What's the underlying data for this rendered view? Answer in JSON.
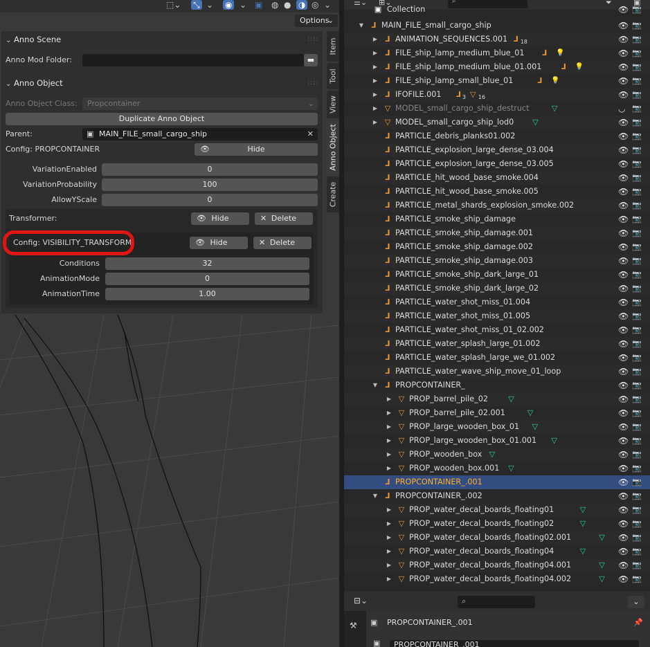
{
  "viewport": {
    "options_label": "Options"
  },
  "panel": {
    "anno_scene": {
      "title": "Anno Scene",
      "mod_folder_label": "Anno Mod Folder:",
      "mod_folder_value": ""
    },
    "anno_object": {
      "title": "Anno Object",
      "class_label": "Anno Object Class:",
      "class_value": "Propcontainer",
      "duplicate_label": "Duplicate Anno Object",
      "parent_label": "Parent:",
      "parent_value": "MAIN_FILE_small_cargo_ship",
      "config_label": "Config: PROPCONTAINER",
      "hide_label": "Hide",
      "variation_enabled_label": "VariationEnabled",
      "variation_enabled_value": "0",
      "variation_probability_label": "VariationProbability",
      "variation_probability_value": "100",
      "allow_yscale_label": "AllowYScale",
      "allow_yscale_value": "0"
    },
    "transformer": {
      "label": "Transformer:",
      "hide_label": "Hide",
      "delete_label": "Delete",
      "config_label": "Config: VISIBILITY_TRANSFORM",
      "config_hide_label": "Hide",
      "config_delete_label": "Delete",
      "conditions_label": "Conditions",
      "conditions_value": "32",
      "animation_mode_label": "AnimationMode",
      "animation_mode_value": "0",
      "animation_time_label": "AnimationTime",
      "animation_time_value": "1.00"
    },
    "tabs": [
      "Item",
      "Tool",
      "View",
      "Anno Object",
      "Create"
    ]
  },
  "outliner": {
    "collection_label": "Collection",
    "rows": [
      {
        "name": "MAIN_FILE_small_cargo_ship",
        "type": "empty",
        "expanded": true
      },
      {
        "name": "ANIMATION_SEQUENCES.001",
        "type": "empty",
        "badge": "18"
      },
      {
        "name": "FILE_ship_lamp_medium_blue_01",
        "type": "empty",
        "badge": "lamp"
      },
      {
        "name": "FILE_ship_lamp_medium_blue_01.001",
        "type": "empty",
        "badge": "lamp"
      },
      {
        "name": "FILE_ship_lamp_small_blue_01",
        "type": "empty",
        "badge": "lamp"
      },
      {
        "name": "IFOFILE.001",
        "type": "empty",
        "badge_a": "3",
        "badge_b": "16"
      },
      {
        "name": "MODEL_small_cargo_ship_destruct",
        "type": "mesh",
        "hidden": true
      },
      {
        "name": "MODEL_small_cargo_ship_lod0",
        "type": "mesh"
      },
      {
        "name": "PARTICLE_debris_planks01.002",
        "type": "empty"
      },
      {
        "name": "PARTICLE_explosion_large_dense_03.004",
        "type": "empty"
      },
      {
        "name": "PARTICLE_explosion_large_dense_03.005",
        "type": "empty"
      },
      {
        "name": "PARTICLE_hit_wood_base_smoke.004",
        "type": "empty"
      },
      {
        "name": "PARTICLE_hit_wood_base_smoke.005",
        "type": "empty"
      },
      {
        "name": "PARTICLE_metal_shards_explosion_smoke.002",
        "type": "empty"
      },
      {
        "name": "PARTICLE_smoke_ship_damage",
        "type": "empty"
      },
      {
        "name": "PARTICLE_smoke_ship_damage.001",
        "type": "empty"
      },
      {
        "name": "PARTICLE_smoke_ship_damage.002",
        "type": "empty"
      },
      {
        "name": "PARTICLE_smoke_ship_damage.003",
        "type": "empty"
      },
      {
        "name": "PARTICLE_smoke_ship_dark_large_01",
        "type": "empty"
      },
      {
        "name": "PARTICLE_smoke_ship_dark_large_02",
        "type": "empty"
      },
      {
        "name": "PARTICLE_water_shot_miss_01.004",
        "type": "empty"
      },
      {
        "name": "PARTICLE_water_shot_miss_01.005",
        "type": "empty"
      },
      {
        "name": "PARTICLE_water_shot_miss_01_02.002",
        "type": "empty"
      },
      {
        "name": "PARTICLE_water_splash_large_01.002",
        "type": "empty"
      },
      {
        "name": "PARTICLE_water_splash_large_we_01.002",
        "type": "empty"
      },
      {
        "name": "PARTICLE_water_wave_ship_move_01_loop",
        "type": "empty"
      },
      {
        "name": "PROPCONTAINER_",
        "type": "empty",
        "expanded": true
      },
      {
        "name": "PROP_barrel_pile_02",
        "type": "mesh"
      },
      {
        "name": "PROP_barrel_pile_02.001",
        "type": "mesh"
      },
      {
        "name": "PROP_large_wooden_box_01",
        "type": "mesh"
      },
      {
        "name": "PROP_large_wooden_box_01.001",
        "type": "mesh"
      },
      {
        "name": "PROP_wooden_box",
        "type": "mesh"
      },
      {
        "name": "PROP_wooden_box.001",
        "type": "mesh"
      },
      {
        "name": "PROPCONTAINER_.001",
        "type": "empty",
        "selected": true
      },
      {
        "name": "PROPCONTAINER_.002",
        "type": "empty",
        "expanded": true
      },
      {
        "name": "PROP_water_decal_boards_floating01",
        "type": "mesh"
      },
      {
        "name": "PROP_water_decal_boards_floating02",
        "type": "mesh"
      },
      {
        "name": "PROP_water_decal_boards_floating02.001",
        "type": "mesh"
      },
      {
        "name": "PROP_water_decal_boards_floating04",
        "type": "mesh"
      },
      {
        "name": "PROP_water_decal_boards_floating04.001",
        "type": "mesh"
      },
      {
        "name": "PROP_water_decal_boards_floating04.002",
        "type": "mesh"
      }
    ]
  },
  "properties": {
    "object_name": "PROPCONTAINER_.001",
    "name_field": "PROPCONTAINER_.001"
  },
  "colors": {
    "accent": "#4772b3",
    "selected_text": "#ffaf29",
    "empty_icon": "#e8953a",
    "mesh_icon": "#2fc9a1",
    "annotation_ring": "#e01515"
  }
}
